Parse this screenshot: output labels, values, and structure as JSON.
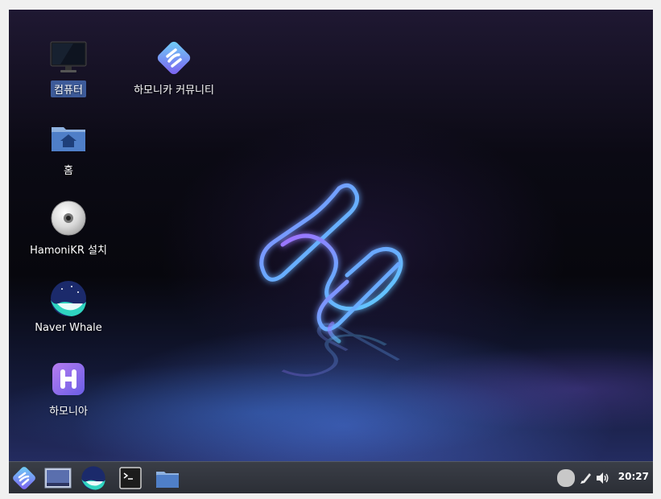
{
  "desktop": {
    "icons": [
      {
        "label": "컴퓨터",
        "icon": "monitor-icon",
        "selected": true
      },
      {
        "label": "하모니카 커뮤니티",
        "icon": "hamonikr-logo-icon"
      },
      {
        "label": "홈",
        "icon": "home-folder-icon"
      },
      {
        "label": "HamoniKR 설치",
        "icon": "cd-disc-icon"
      },
      {
        "label": "Naver Whale",
        "icon": "whale-browser-icon"
      },
      {
        "label": "하모니아",
        "icon": "hamonia-icon"
      }
    ]
  },
  "taskbar": {
    "launchers": [
      {
        "icon": "hamonikr-menu-icon"
      },
      {
        "icon": "show-desktop-icon"
      },
      {
        "icon": "whale-browser-icon"
      },
      {
        "icon": "terminal-icon"
      },
      {
        "icon": "folder-icon"
      }
    ],
    "tray": {
      "status_icon": "user-status-icon",
      "pen_icon": "pen-icon",
      "volume_icon": "volume-icon",
      "clock": "20:27"
    }
  },
  "colors": {
    "taskbar": "#2e3138",
    "selection": "#3d5b9a",
    "neon_blue": "#5fd0ff",
    "neon_purple": "#a070ff"
  }
}
